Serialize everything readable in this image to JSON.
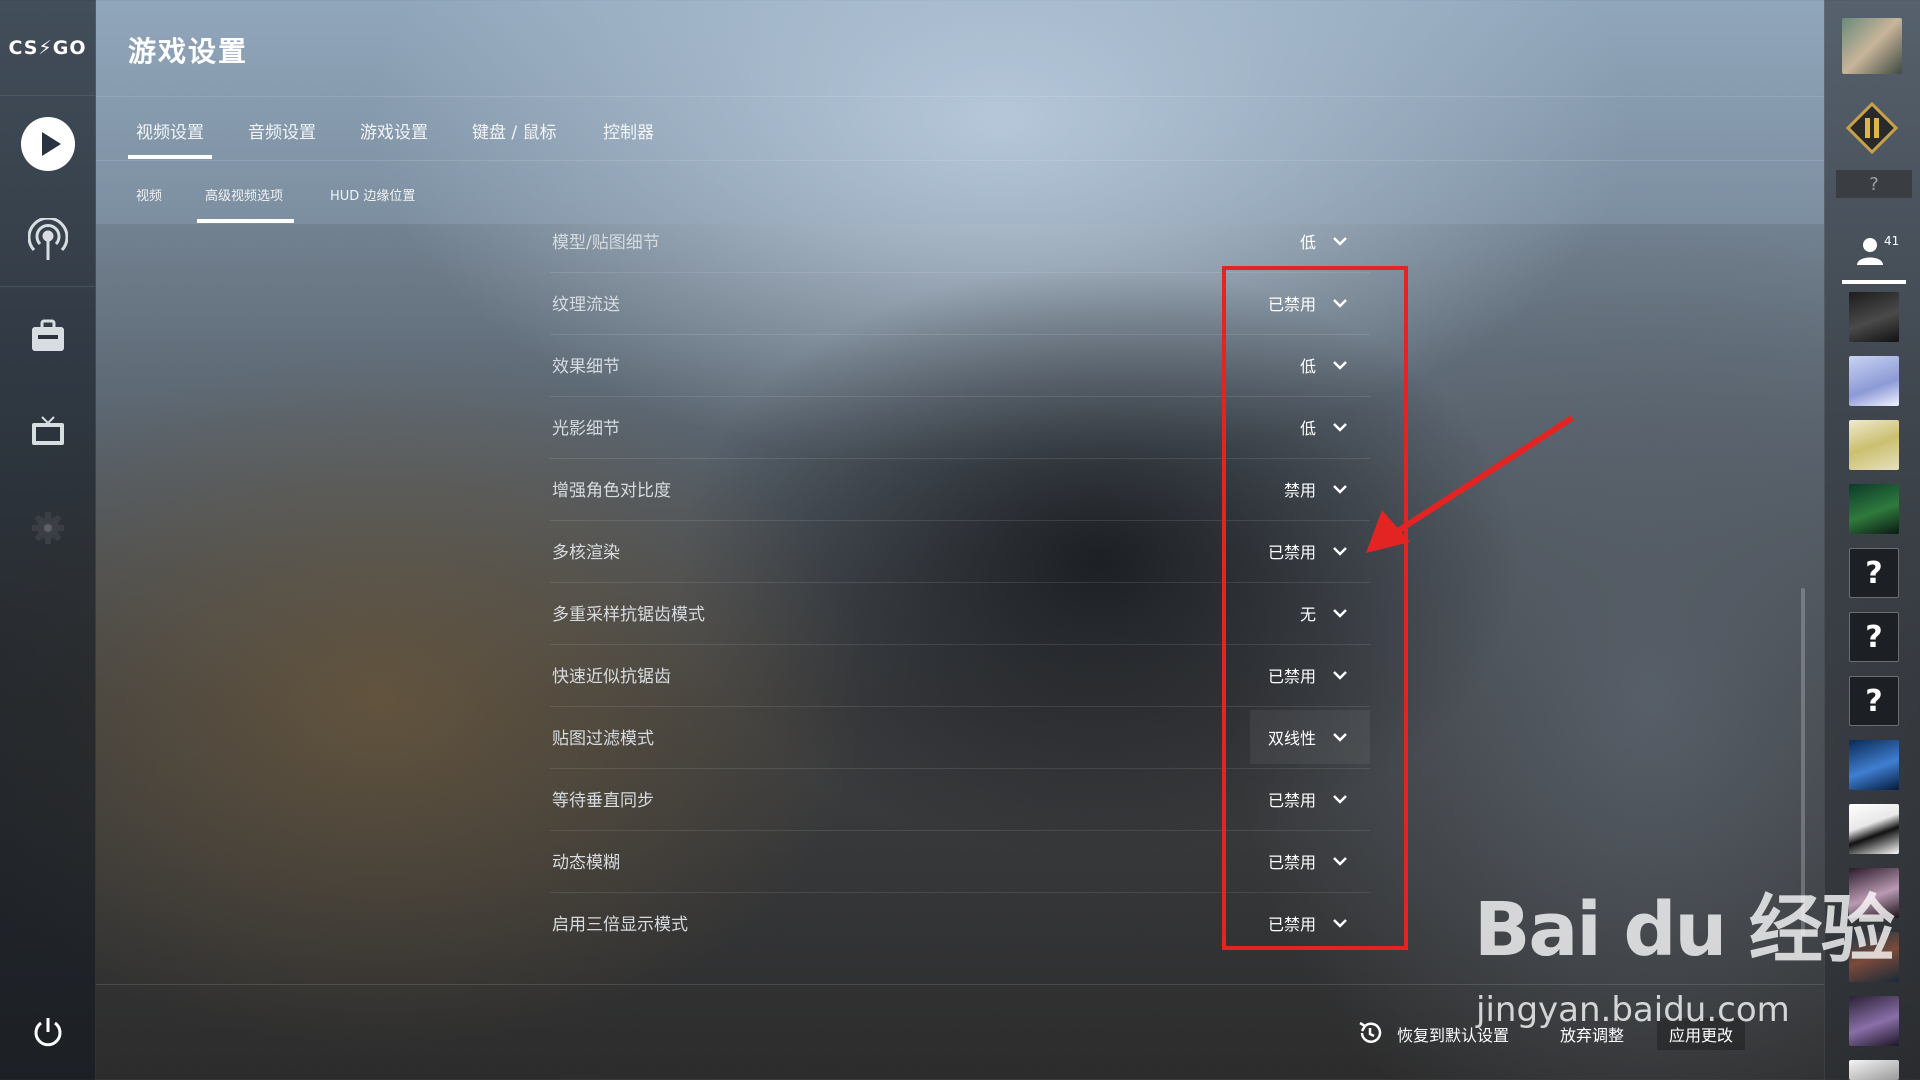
{
  "app": {
    "logo_text": "CS⚡GO"
  },
  "header": {
    "title": "游戏设置"
  },
  "tabs": [
    {
      "label": "视频设置",
      "active": true
    },
    {
      "label": "音频设置"
    },
    {
      "label": "游戏设置"
    },
    {
      "label": "键盘 / 鼠标"
    },
    {
      "label": "控制器"
    }
  ],
  "subtabs": [
    {
      "label": "视频"
    },
    {
      "label": "高级视频选项",
      "active": true
    },
    {
      "label": "HUD 边缘位置"
    }
  ],
  "settings": [
    {
      "label": "模型/贴图细节",
      "value": "低"
    },
    {
      "label": "纹理流送",
      "value": "已禁用"
    },
    {
      "label": "效果细节",
      "value": "低"
    },
    {
      "label": "光影细节",
      "value": "低"
    },
    {
      "label": "增强角色对比度",
      "value": "禁用"
    },
    {
      "label": "多核渲染",
      "value": "已禁用"
    },
    {
      "label": "多重采样抗锯齿模式",
      "value": "无"
    },
    {
      "label": "快速近似抗锯齿",
      "value": "已禁用"
    },
    {
      "label": "贴图过滤模式",
      "value": "双线性"
    },
    {
      "label": "等待垂直同步",
      "value": "已禁用"
    },
    {
      "label": "动态模糊",
      "value": "已禁用"
    },
    {
      "label": "启用三倍显示模式",
      "value": "已禁用"
    }
  ],
  "footer": {
    "reset_label": "恢复到默认设置",
    "discard_label": "放弃调整",
    "apply_label": "应用更改"
  },
  "social": {
    "rank_placeholder": "?",
    "friend_count": "41",
    "unknown_avatar": "?"
  },
  "watermark": {
    "brand": "Bai du 经验",
    "url": "jingyan.baidu.com"
  },
  "colors": {
    "highlight": "#e42323",
    "accent": "#ffffff"
  }
}
